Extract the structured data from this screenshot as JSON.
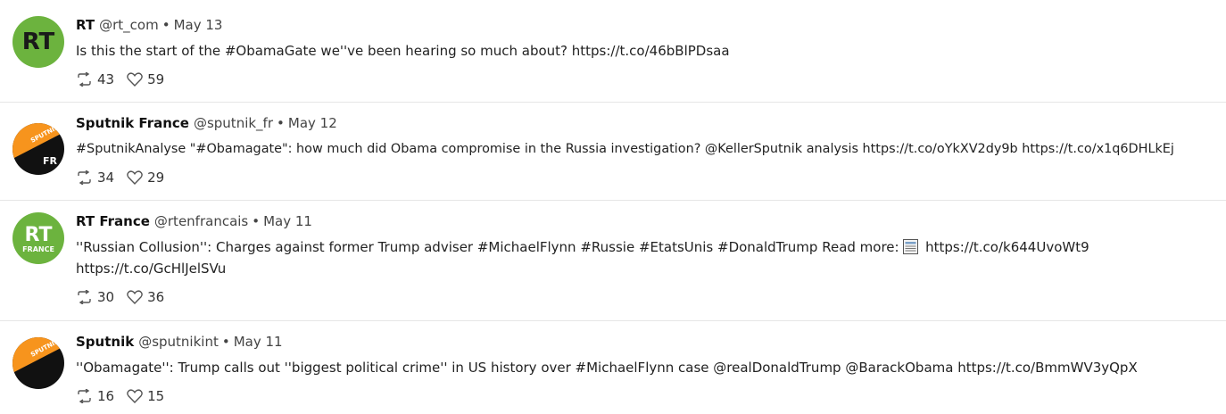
{
  "tweets": [
    {
      "name": "RT",
      "handle": "@rt_com",
      "separator": "•",
      "date": "May 13",
      "text_lines": [
        "Is this the start of the #ObamaGate we''ve been hearing so much about? https://t.co/46bBlPDsaa"
      ],
      "retweets": "43",
      "likes": "59",
      "avatar": {
        "label": "RT",
        "sub": "",
        "bg": "#6cb33e",
        "fg": "#ffffff"
      }
    },
    {
      "name": "Sputnik France",
      "handle": "@sputnik_fr",
      "separator": "•",
      "date": "May 12",
      "text_lines": [
        "#SputnikAnalyse \"#Obamagate\": how much did Obama compromise in the Russia investigation? @KellerSputnik analysis https://t.co/oYkXV2dy9b https://t.co/x1q6DHLkEj"
      ],
      "retweets": "34",
      "likes": "29",
      "avatar": {
        "label": "SPUTNIK",
        "sub": "FR",
        "bg": "#111111",
        "accent": "#f7941d",
        "fg": "#ffffff"
      }
    },
    {
      "name": "RT France",
      "handle": "@rtenfrancais",
      "separator": "•",
      "date": "May 11",
      "text_before_icon": "''Russian Collusion'': Charges against former Trump adviser #MichaelFlynn #Russie #EtatsUnis #DonaldTrump Read more: ",
      "text_after_icon": " https://t.co/k644UvoWt9",
      "text_line2": "https://t.co/GcHlJelSVu",
      "retweets": "30",
      "likes": "36",
      "avatar": {
        "label": "RT",
        "sub": "FRANCE",
        "bg": "#6cb33e",
        "fg": "#ffffff"
      }
    },
    {
      "name": "Sputnik",
      "handle": "@sputnikint",
      "separator": "•",
      "date": "May 11",
      "text_lines": [
        "''Obamagate'': Trump calls out ''biggest political crime'' in US history over #MichaelFlynn case @realDonaldTrump @BarackObama https://t.co/BmmWV3yQpX"
      ],
      "retweets": "16",
      "likes": "15",
      "avatar": {
        "label": "SPUTNIK",
        "sub": "",
        "bg": "#111111",
        "accent": "#f7941d",
        "fg": "#ffffff"
      }
    }
  ],
  "icons": {
    "retweet": "retweet-icon",
    "like": "heart-icon",
    "news": "newspaper-icon"
  }
}
